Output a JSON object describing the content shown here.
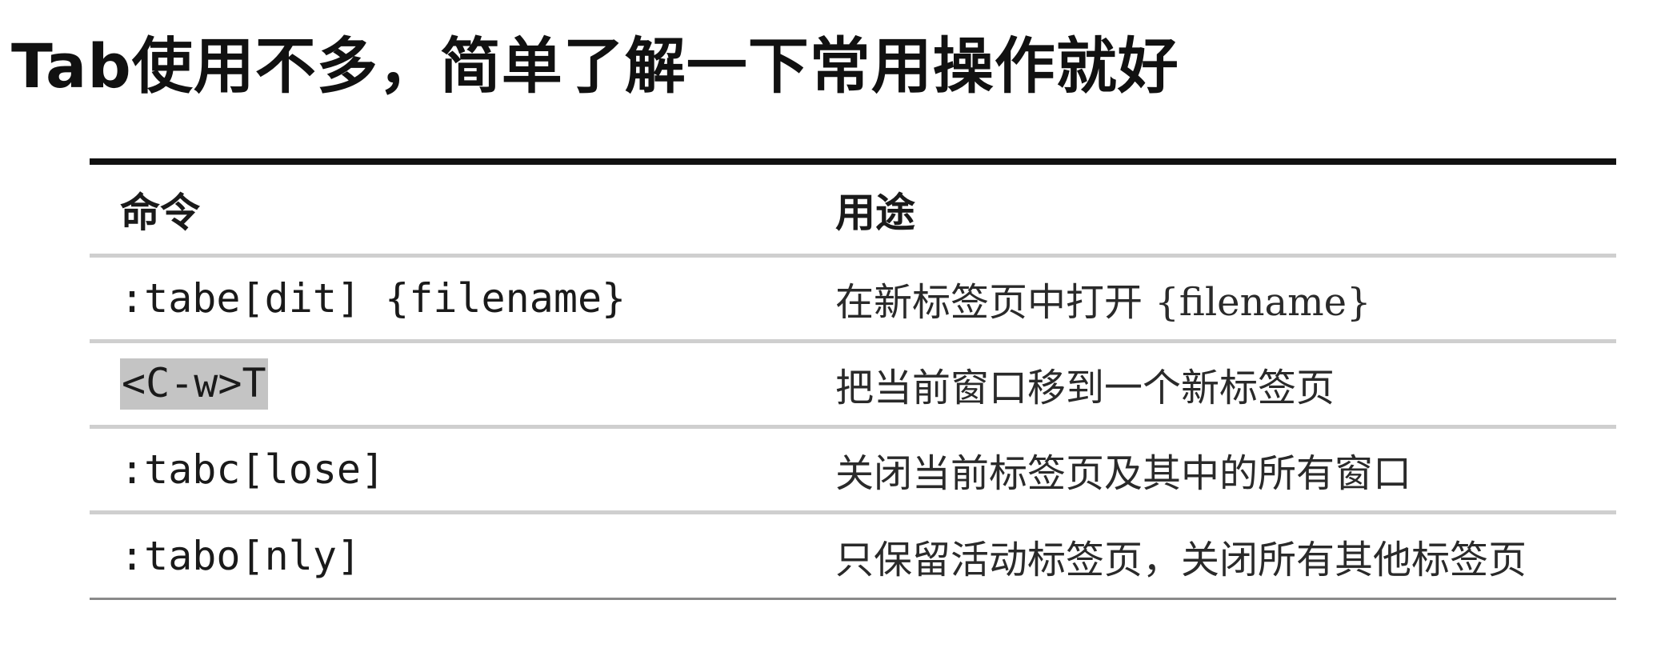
{
  "title": "Tab使用不多，简单了解一下常用操作就好",
  "table": {
    "headers": {
      "command": "命令",
      "usage": "用途"
    },
    "rows": [
      {
        "command": ":tabe[dit] {filename}",
        "usage": "在新标签页中打开 {filename}"
      },
      {
        "command": "<C-w>T",
        "usage": "把当前窗口移到一个新标签页",
        "highlighted": true
      },
      {
        "command": ":tabc[lose]",
        "usage": "关闭当前标签页及其中的所有窗口"
      },
      {
        "command": ":tabo[nly]",
        "usage": "只保留活动标签页，关闭所有其他标签页"
      }
    ]
  },
  "colors": {
    "text": "#1a1a1a",
    "rule_dark": "#111111",
    "rule_light": "#cfcfcf",
    "highlight": "#c4c4c4"
  }
}
